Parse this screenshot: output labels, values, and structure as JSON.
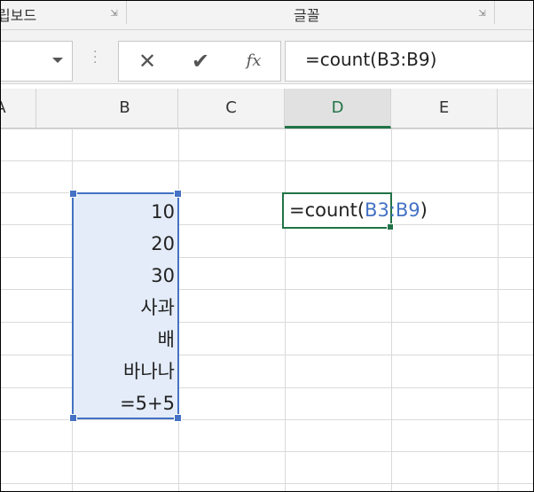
{
  "ribbon": {
    "clipboard_label": "립보드",
    "font_label": "글꼴"
  },
  "formula_bar": {
    "cancel_glyph": "✕",
    "enter_glyph": "✔",
    "fx_glyph": "fx",
    "formula": "=count(B3:B9)"
  },
  "columns": [
    "A",
    "B",
    "C",
    "D",
    "E"
  ],
  "active_column": "D",
  "cells": {
    "B3": "10",
    "B4": "20",
    "B5": "30",
    "B6": "사과",
    "B7": "배",
    "B8": "바나나",
    "B9": "=5+5"
  },
  "editing": {
    "prefix": "=count(",
    "reference": "B3:B9",
    "suffix": ")"
  },
  "colors": {
    "accent_green": "#217346",
    "reference_blue": "#4472c4",
    "range_fill": "#e3ecf8"
  }
}
